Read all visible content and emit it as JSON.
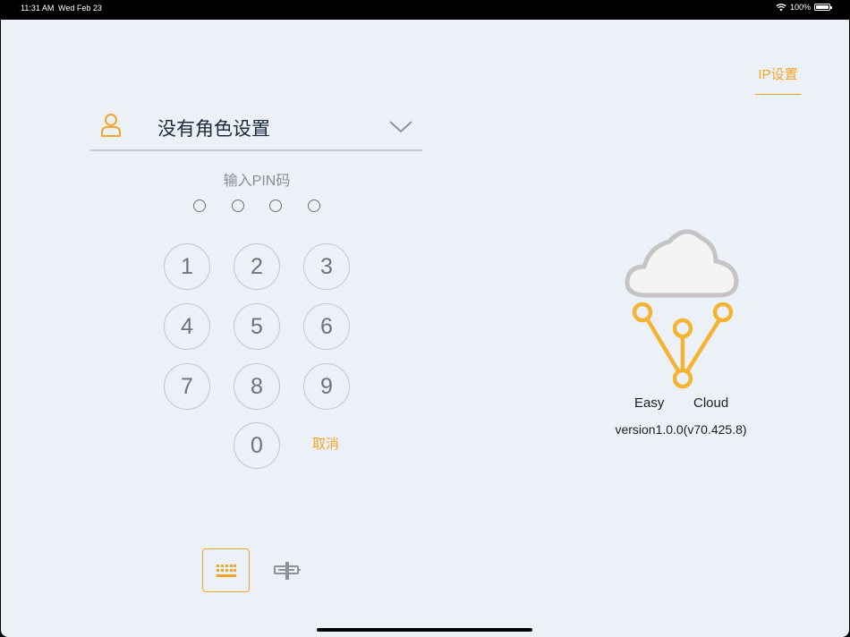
{
  "status_bar": {
    "time": "11:31 AM",
    "date": "Wed Feb 23",
    "battery": "100%"
  },
  "header": {
    "ip_settings_label": "IP设置"
  },
  "role": {
    "label": "没有角色设置",
    "icon": "user-icon"
  },
  "pin": {
    "label": "输入PIN码",
    "entered_count": 0,
    "length": 4
  },
  "keypad": {
    "keys": [
      "1",
      "2",
      "3",
      "4",
      "5",
      "6",
      "7",
      "8",
      "9",
      "0"
    ],
    "cancel_label": "取消"
  },
  "input_modes": {
    "selected": "keyboard",
    "items": [
      "keyboard-icon",
      "scanner-icon"
    ]
  },
  "brand": {
    "word1": "Easy",
    "word2": "Cloud",
    "version": "version1.0.0(v70.425.8)"
  },
  "colors": {
    "accent": "#f2a52a",
    "background": "#ecf1f7",
    "cloud": "#c9c9c9"
  }
}
